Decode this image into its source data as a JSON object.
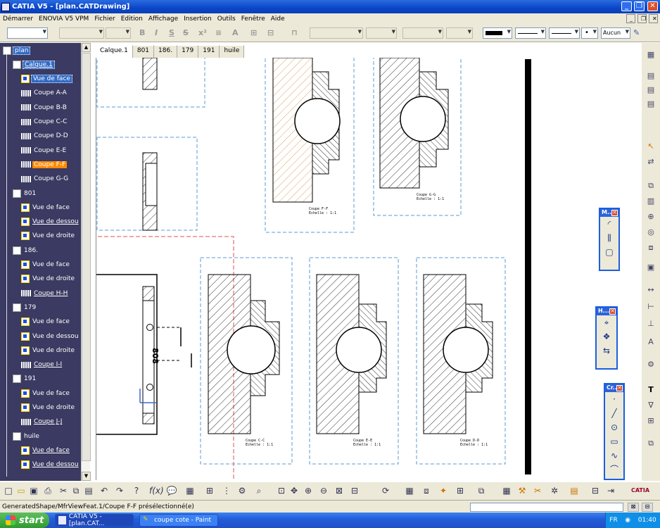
{
  "window": {
    "title": "CATIA V5 - [plan.CATDrawing]"
  },
  "menu": [
    "Démarrer",
    "ENOVIA V5 VPM",
    "Fichier",
    "Edition",
    "Affichage",
    "Insertion",
    "Outils",
    "Fenêtre",
    "Aide"
  ],
  "toolbar": {
    "line_style_label": "Aucun"
  },
  "tree": {
    "root": "plan",
    "nodes": [
      {
        "label": "Calque.1",
        "type": "sheet",
        "level": 1,
        "state": "sel-ul"
      },
      {
        "label": "Vue de face",
        "type": "view",
        "level": 2,
        "state": "sel"
      },
      {
        "label": "Coupe A-A",
        "type": "sec",
        "level": 2,
        "state": ""
      },
      {
        "label": "Coupe B-B",
        "type": "sec",
        "level": 2,
        "state": ""
      },
      {
        "label": "Coupe C-C",
        "type": "sec",
        "level": 2,
        "state": ""
      },
      {
        "label": "Coupe D-D",
        "type": "sec",
        "level": 2,
        "state": ""
      },
      {
        "label": "Coupe E-E",
        "type": "sec",
        "level": 2,
        "state": ""
      },
      {
        "label": "Coupe F-F",
        "type": "sec",
        "level": 2,
        "state": "hot"
      },
      {
        "label": "Coupe G-G",
        "type": "sec",
        "level": 2,
        "state": ""
      },
      {
        "label": "801",
        "type": "sheet",
        "level": 1,
        "state": ""
      },
      {
        "label": "Vue de face",
        "type": "view",
        "level": 2,
        "state": ""
      },
      {
        "label": "Vue de dessou",
        "type": "view",
        "level": 2,
        "state": "ul"
      },
      {
        "label": "Vue de droite",
        "type": "view",
        "level": 2,
        "state": ""
      },
      {
        "label": "186.",
        "type": "sheet",
        "level": 1,
        "state": ""
      },
      {
        "label": "Vue de face",
        "type": "view",
        "level": 2,
        "state": ""
      },
      {
        "label": "Vue de droite",
        "type": "view",
        "level": 2,
        "state": ""
      },
      {
        "label": "Coupe H-H",
        "type": "sec",
        "level": 2,
        "state": "ul"
      },
      {
        "label": "179",
        "type": "sheet",
        "level": 1,
        "state": ""
      },
      {
        "label": "Vue de face",
        "type": "view",
        "level": 2,
        "state": ""
      },
      {
        "label": "Vue de dessou",
        "type": "view",
        "level": 2,
        "state": ""
      },
      {
        "label": "Vue de droite",
        "type": "view",
        "level": 2,
        "state": ""
      },
      {
        "label": "Coupe I-I",
        "type": "sec",
        "level": 2,
        "state": "ul"
      },
      {
        "label": "191",
        "type": "sheet",
        "level": 1,
        "state": ""
      },
      {
        "label": "Vue de face",
        "type": "view",
        "level": 2,
        "state": ""
      },
      {
        "label": "Vue de droite",
        "type": "view",
        "level": 2,
        "state": ""
      },
      {
        "label": "Coupe J-J",
        "type": "sec",
        "level": 2,
        "state": "ul"
      },
      {
        "label": "huile",
        "type": "sheet",
        "level": 1,
        "state": ""
      },
      {
        "label": "Vue de face",
        "type": "view",
        "level": 2,
        "state": "ul"
      },
      {
        "label": "Vue de dessou",
        "type": "view",
        "level": 2,
        "state": "ul"
      }
    ]
  },
  "sheet_tabs": [
    "Calque.1",
    "801",
    "186.",
    "179",
    "191",
    "huile"
  ],
  "drawing": {
    "sections": [
      {
        "title": "Coupe F-F",
        "scale": "Echelle : 1:1"
      },
      {
        "title": "Coupe G-G",
        "scale": "Echelle : 1:1"
      },
      {
        "title": "Coupe C-C",
        "scale": "Echelle : 1:1"
      },
      {
        "title": "Coupe E-E",
        "scale": "Echelle : 1:1"
      },
      {
        "title": "Coupe D-D",
        "scale": "Echelle : 1:1"
      }
    ],
    "part_number": "808"
  },
  "palettes": [
    {
      "title": "M..."
    },
    {
      "title": "H..."
    },
    {
      "title": "Cr..."
    }
  ],
  "status": {
    "message": "GeneratedShape/MfrViewFeat.1/Coupe F-F présélectionné(e)"
  },
  "taskbar": {
    "start": "start",
    "tasks": [
      "CATIA V5 - [plan.CAT...",
      "coupe cote - Paint"
    ],
    "lang": "FR",
    "clock": "01:40"
  },
  "brand": {
    "catia": "CATIA"
  }
}
